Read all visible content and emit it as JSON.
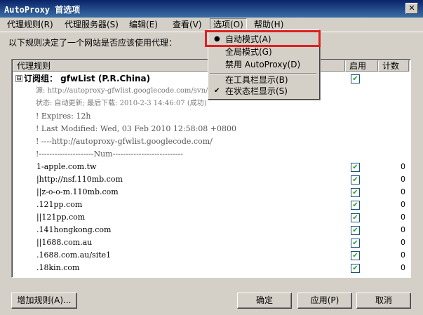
{
  "window": {
    "title": "AutoProxy 首选项",
    "close_glyph": "✕"
  },
  "menubar": [
    "代理规则(R)",
    "代理服务器(S)",
    "编辑(E)",
    "查看(V)",
    "选项(O)",
    "帮助(H)"
  ],
  "intro": "以下规则决定了一个网站是否应该使用代理：",
  "table": {
    "headers": [
      "代理规则",
      "启用",
      "计数"
    ],
    "group": {
      "expander": "⊟",
      "label": "订阅组： gfwList (P.R.China)",
      "enabled": true
    },
    "comments": [
      "源: http://autoproxy-gfwlist.googlecode.com/svn/...",
      "状态: 自动更新; 最后下载: 2010-2-3 14:46:07 (成功)",
      "! Expires: 12h",
      "! Last Modified:  Wed, 03 Feb 2010 12:58:08 +0800",
      "!     ----http://autoproxy-gfwlist.googlecode.com/",
      "!---------------------Num---------------------------"
    ],
    "rules": [
      {
        "text": "1-apple.com.tw",
        "enabled": true,
        "count": "0"
      },
      {
        "text": "|http://nsf.110mb.com",
        "enabled": true,
        "count": "0"
      },
      {
        "text": "||z-o-o-m.110mb.com",
        "enabled": true,
        "count": "0"
      },
      {
        "text": ".121pp.com",
        "enabled": true,
        "count": "0"
      },
      {
        "text": "||121pp.com",
        "enabled": true,
        "count": "0"
      },
      {
        "text": ".141hongkong.com",
        "enabled": true,
        "count": "0"
      },
      {
        "text": "||1688.com.au",
        "enabled": true,
        "count": "0"
      },
      {
        "text": ".1688.com.au/site1",
        "enabled": true,
        "count": "0"
      },
      {
        "text": ".18kin.com",
        "enabled": true,
        "count": "0"
      }
    ]
  },
  "options_menu": {
    "items": [
      {
        "label": "自动模式(A)",
        "mark": "●"
      },
      {
        "label": "全局模式(G)",
        "mark": ""
      },
      {
        "label": "禁用 AutoProxy(D)",
        "mark": ""
      },
      {
        "label": "在工具栏显示(B)",
        "mark": ""
      },
      {
        "label": "在状态栏显示(S)",
        "mark": "✔"
      }
    ]
  },
  "buttons": {
    "add_rule": "增加规则(A)...",
    "ok": "确定",
    "apply": "应用(P)",
    "cancel": "取消"
  },
  "check_glyph": "✔",
  "colors": {
    "titlebar": "#0a246a",
    "highlight": "#e02020"
  }
}
